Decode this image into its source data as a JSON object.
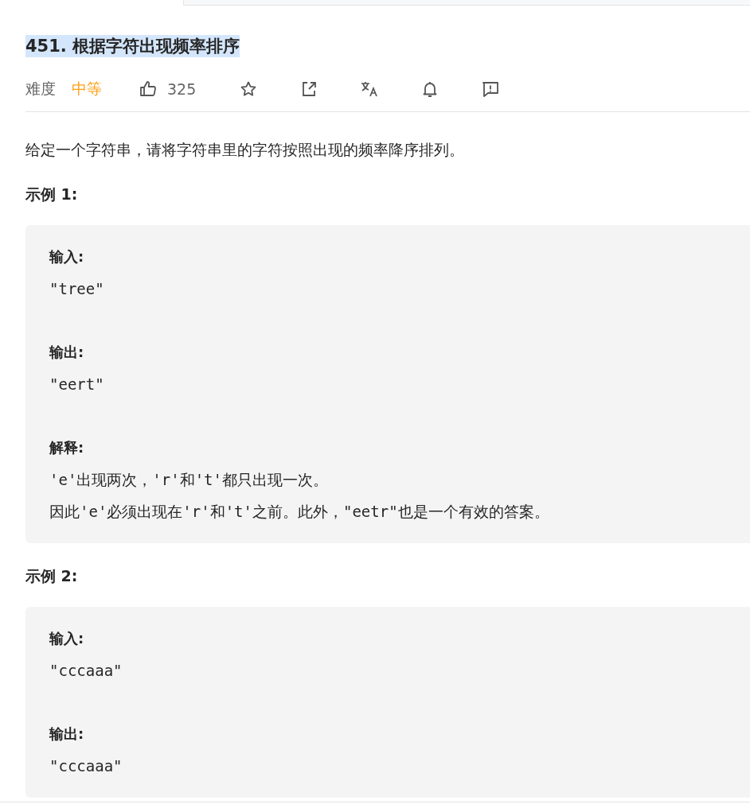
{
  "title": "451. 根据字符出现频率排序",
  "difficulty_label": "难度",
  "difficulty": {
    "text": "中等",
    "kind": "medium"
  },
  "likes": "325",
  "description": "给定一个字符串，请将字符串里的字符按照出现的频率降序排列。",
  "examples": [
    {
      "heading": "示例 1:",
      "sections": [
        {
          "label": "输入:",
          "lines": [
            "\"tree\""
          ]
        },
        {
          "label": "输出:",
          "lines": [
            "\"eert\""
          ]
        },
        {
          "label": "解释:",
          "lines": [
            "'e'出现两次，'r'和't'都只出现一次。",
            "因此'e'必须出现在'r'和't'之前。此外，\"eetr\"也是一个有效的答案。"
          ]
        }
      ]
    },
    {
      "heading": "示例 2:",
      "sections": [
        {
          "label": "输入:",
          "lines": [
            "\"cccaaa\""
          ]
        },
        {
          "label": "输出:",
          "lines": [
            "\"cccaaa\""
          ]
        }
      ]
    }
  ]
}
